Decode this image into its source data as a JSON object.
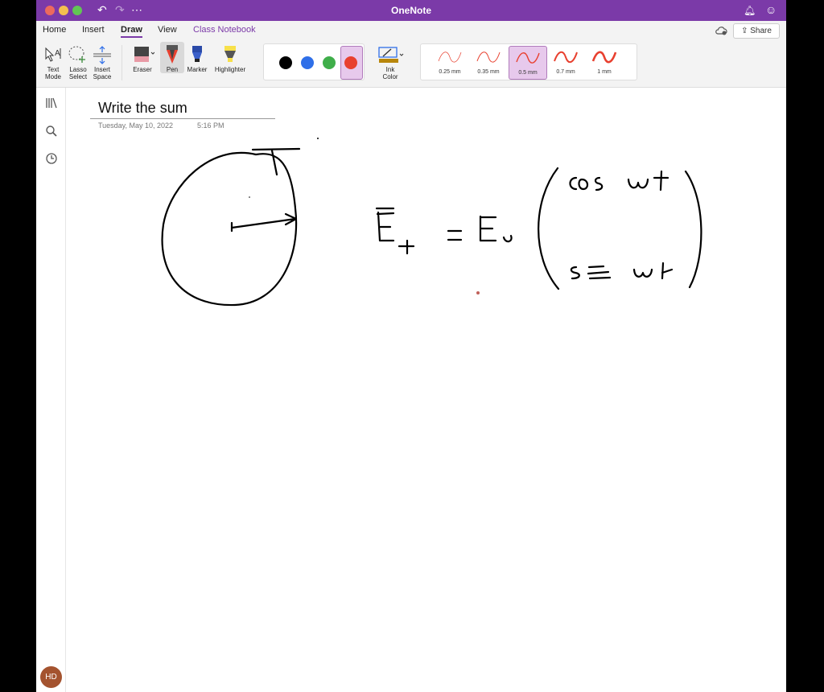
{
  "app": {
    "title": "OneNote"
  },
  "colors": {
    "brand": "#7b3aa8",
    "selected_bg": "#e7c9ec",
    "ink": "#000000",
    "close": "#ec6a5e",
    "minimize": "#f4bf4f",
    "maximize": "#61c554"
  },
  "tabs": [
    {
      "label": "Home"
    },
    {
      "label": "Insert"
    },
    {
      "label": "Draw",
      "active": true
    },
    {
      "label": "View"
    },
    {
      "label": "Class Notebook"
    }
  ],
  "share": {
    "label": "Share"
  },
  "ribbon": {
    "tools": [
      {
        "label1": "Text",
        "label2": "Mode",
        "icon": "text-mode-icon"
      },
      {
        "label1": "Lasso",
        "label2": "Select",
        "icon": "lasso-select-icon"
      },
      {
        "label1": "Insert",
        "label2": "Space",
        "icon": "insert-space-icon"
      },
      {
        "label1": "Eraser",
        "label2": "",
        "icon": "eraser-icon"
      },
      {
        "label1": "Pen",
        "label2": "",
        "icon": "pen-icon"
      },
      {
        "label1": "Marker",
        "label2": "",
        "icon": "marker-icon"
      },
      {
        "label1": "Highlighter",
        "label2": "",
        "icon": "highlighter-icon"
      },
      {
        "label1": "Ink",
        "label2": "Color",
        "icon": "ink-color-icon"
      }
    ],
    "pen_colors": [
      "#000000",
      "#2f6fe8",
      "#3fae4a",
      "#e8402f"
    ],
    "selected_color": "#e8402f",
    "thickness": [
      {
        "label": "0.25 mm"
      },
      {
        "label": "0.35 mm"
      },
      {
        "label": "0.5 mm",
        "selected": true
      },
      {
        "label": "0.7 mm"
      },
      {
        "label": "1 mm"
      }
    ]
  },
  "page": {
    "title": "Write the sum",
    "date": "Tuesday, May 10, 2022",
    "time": "5:16 PM"
  },
  "sidebar": {
    "items": [
      {
        "icon": "notebooks-icon"
      },
      {
        "icon": "search-icon"
      },
      {
        "icon": "recent-icon"
      }
    ],
    "avatar": "HD"
  }
}
